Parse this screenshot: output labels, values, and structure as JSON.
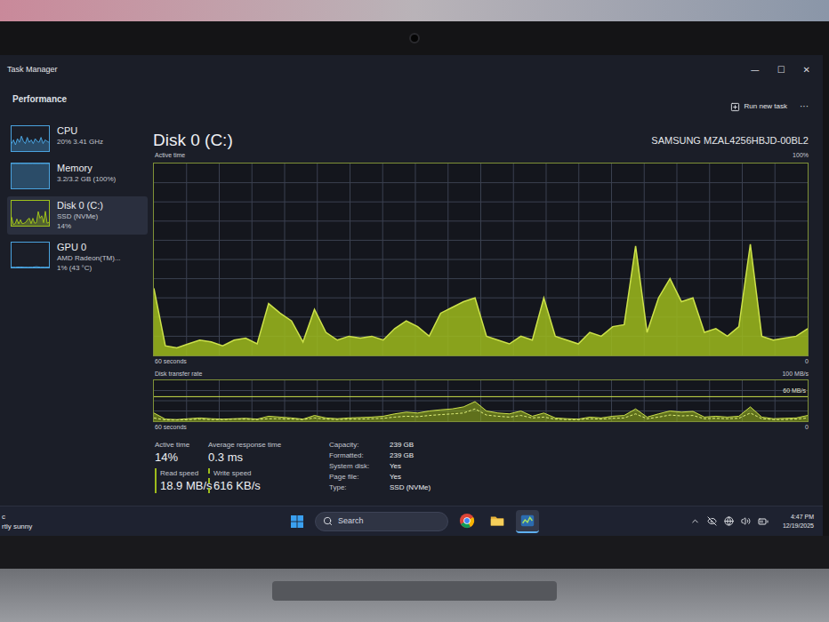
{
  "window": {
    "title": "Task Manager",
    "controls": [
      "—",
      "☐",
      "✕"
    ]
  },
  "header": {
    "page": "Performance",
    "run_new_task": "Run new task",
    "more": "···"
  },
  "sidebar": {
    "items": [
      {
        "name": "CPU",
        "details": [
          "20% 3.41 GHz"
        ],
        "selected": false,
        "color": "#4aa3df",
        "values": [
          30,
          45,
          25,
          50,
          35,
          60,
          40,
          30,
          55,
          35,
          45,
          30,
          50,
          40,
          35,
          55,
          30,
          45,
          40,
          35
        ]
      },
      {
        "name": "Memory",
        "details": [
          "3.2/3.2 GB (100%)"
        ],
        "selected": false,
        "color": "#4aa3df",
        "values": [
          100,
          100,
          100,
          100,
          100,
          100,
          100,
          100,
          100,
          100
        ]
      },
      {
        "name": "Disk 0 (C:)",
        "details": [
          "SSD (NVMe)",
          "14%"
        ],
        "selected": true,
        "color": "#9fc21b",
        "values": [
          35,
          5,
          8,
          27,
          7,
          24,
          8,
          10,
          14,
          25,
          30,
          8,
          30,
          10,
          12,
          57,
          30,
          40,
          12,
          58,
          10,
          14
        ]
      },
      {
        "name": "GPU 0",
        "details": [
          "AMD Radeon(TM)...",
          "1% (43 °C)"
        ],
        "selected": false,
        "color": "#4aa3df",
        "values": [
          1,
          1,
          2,
          1,
          1,
          1,
          3,
          1,
          1,
          1
        ]
      }
    ]
  },
  "disk": {
    "title": "Disk 0 (C:)",
    "model": "SAMSUNG MZAL4256HBJD-00BL2"
  },
  "active_chart": {
    "label": "Active time",
    "max_label": "100%",
    "x_label": "60 seconds",
    "min_label": "0",
    "max": 100,
    "values": [
      35,
      5,
      4,
      6,
      8,
      7,
      5,
      8,
      9,
      6,
      27,
      22,
      18,
      7,
      24,
      12,
      8,
      10,
      9,
      10,
      8,
      14,
      18,
      15,
      10,
      22,
      25,
      28,
      30,
      10,
      8,
      6,
      10,
      8,
      30,
      10,
      8,
      6,
      12,
      10,
      15,
      16,
      57,
      12,
      30,
      40,
      28,
      30,
      12,
      14,
      10,
      15,
      58,
      10,
      8,
      9,
      10,
      14
    ]
  },
  "transfer_chart": {
    "label": "Disk transfer rate",
    "max_label": "100 MB/s",
    "ref_label": "60 MB/s",
    "ref_value": 60,
    "x_label": "60 seconds",
    "min_label": "0",
    "max": 100,
    "series": [
      {
        "kind": "area",
        "values": [
          20,
          5,
          4,
          6,
          8,
          6,
          5,
          6,
          7,
          5,
          12,
          10,
          8,
          5,
          14,
          8,
          6,
          8,
          9,
          10,
          12,
          18,
          22,
          20,
          25,
          28,
          30,
          35,
          48,
          25,
          20,
          18,
          25,
          12,
          20,
          8,
          6,
          5,
          10,
          8,
          12,
          14,
          30,
          10,
          18,
          25,
          22,
          24,
          10,
          12,
          10,
          12,
          35,
          10,
          6,
          7,
          8,
          14
        ]
      },
      {
        "kind": "line",
        "values": [
          8,
          3,
          3,
          4,
          5,
          4,
          4,
          5,
          5,
          4,
          6,
          6,
          5,
          4,
          8,
          5,
          4,
          5,
          5,
          6,
          7,
          10,
          12,
          11,
          14,
          16,
          18,
          20,
          30,
          15,
          12,
          10,
          14,
          8,
          10,
          5,
          4,
          4,
          6,
          5,
          7,
          8,
          18,
          6,
          10,
          15,
          13,
          14,
          6,
          7,
          6,
          7,
          20,
          6,
          4,
          4,
          5,
          8
        ]
      }
    ]
  },
  "stats": [
    {
      "label": "Active time",
      "value": "14%",
      "kind": "plain"
    },
    {
      "label": "Average response time",
      "value": "0.3 ms",
      "kind": "plain"
    },
    {
      "label": "Read speed",
      "value": "18.9 MB/s",
      "kind": "solid"
    },
    {
      "label": "Write speed",
      "value": "616 KB/s",
      "kind": "dashed"
    }
  ],
  "properties": [
    {
      "label": "Capacity:",
      "value": "239 GB"
    },
    {
      "label": "Formatted:",
      "value": "239 GB"
    },
    {
      "label": "System disk:",
      "value": "Yes"
    },
    {
      "label": "Page file:",
      "value": "Yes"
    },
    {
      "label": "Type:",
      "value": "SSD (NVMe)"
    }
  ],
  "taskbar": {
    "weather": [
      "c",
      "rtly sunny"
    ],
    "search": "Search",
    "apps": [
      {
        "kind": "chrome",
        "selected": false
      },
      {
        "kind": "explorer",
        "selected": false
      },
      {
        "kind": "taskmgr",
        "selected": true
      }
    ],
    "time": "4:47 PM",
    "date": "12/19/2025"
  }
}
